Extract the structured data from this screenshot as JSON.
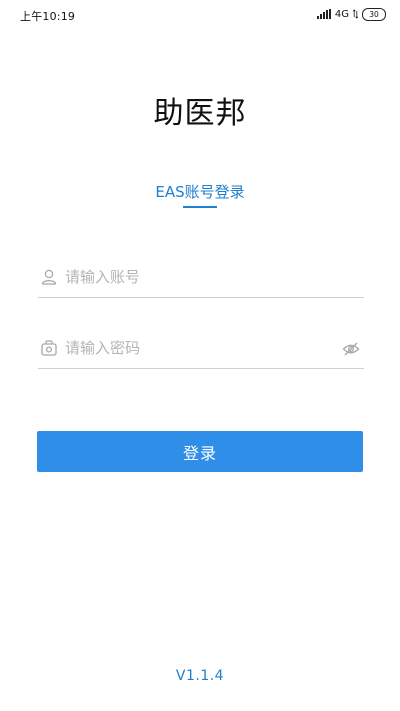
{
  "status_bar": {
    "time": "上午10:19",
    "network": "4G",
    "battery": "30"
  },
  "app": {
    "title": "助医邦"
  },
  "login_tab": {
    "label": "EAS账号登录",
    "accent_color": "#1e7fd0"
  },
  "form": {
    "account_placeholder": "请输入账号",
    "account_value": "",
    "password_placeholder": "请输入密码",
    "password_value": "",
    "account_icon": "user-icon",
    "password_icon": "lock-icon",
    "toggle_icon": "eye-off-icon"
  },
  "login_button": {
    "label": "登录",
    "color": "#2f8fe8"
  },
  "footer": {
    "version": "V1.1.4"
  }
}
